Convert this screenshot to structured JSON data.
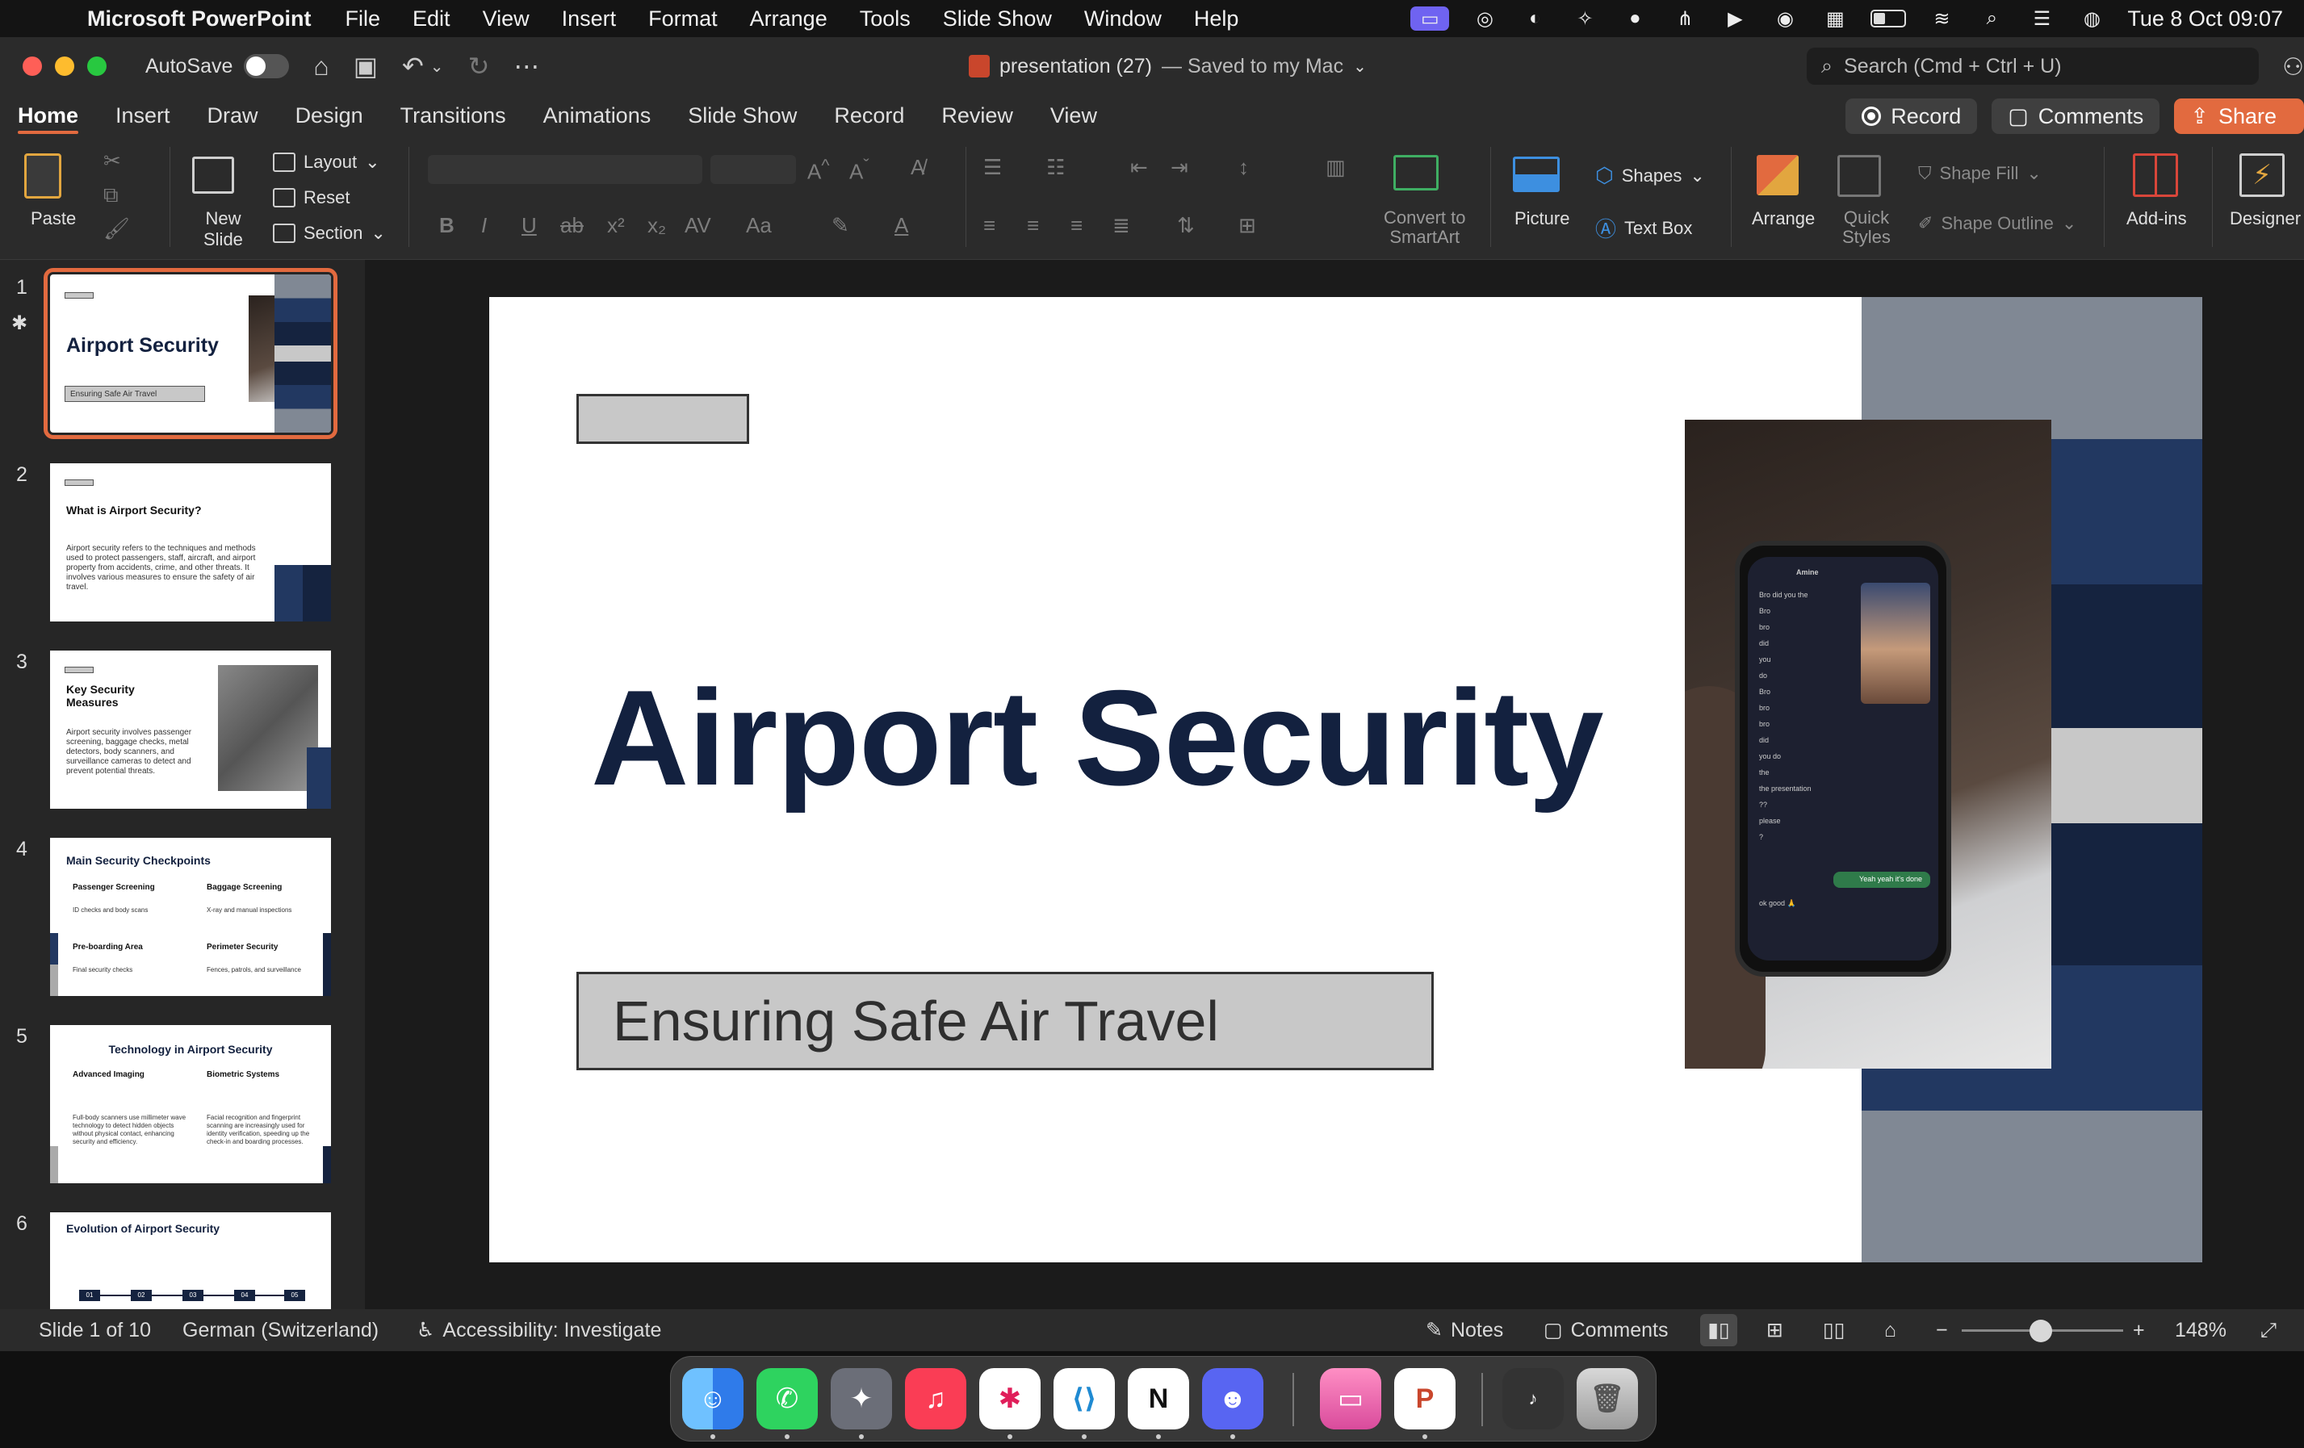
{
  "menubar": {
    "app_name": "Microsoft PowerPoint",
    "items": [
      "File",
      "Edit",
      "View",
      "Insert",
      "Format",
      "Arrange",
      "Tools",
      "Slide Show",
      "Window",
      "Help"
    ],
    "datetime": "Tue 8 Oct  09:07"
  },
  "titlebar": {
    "autosave_label": "AutoSave",
    "doc_name": "presentation (27)",
    "saved_status": "— Saved to my Mac",
    "search_placeholder": "Search (Cmd + Ctrl + U)"
  },
  "ribbon_tabs": [
    "Home",
    "Insert",
    "Draw",
    "Design",
    "Transitions",
    "Animations",
    "Slide Show",
    "Record",
    "Review",
    "View"
  ],
  "tab_actions": {
    "record": "Record",
    "comments": "Comments",
    "share": "Share"
  },
  "ribbon": {
    "paste": "Paste",
    "new_slide_line1": "New",
    "new_slide_line2": "Slide",
    "layout": "Layout",
    "reset": "Reset",
    "section": "Section",
    "convert_line1": "Convert to",
    "convert_line2": "SmartArt",
    "picture": "Picture",
    "shapes": "Shapes",
    "text_box": "Text Box",
    "arrange": "Arrange",
    "quick_styles_line1": "Quick",
    "quick_styles_line2": "Styles",
    "shape_fill": "Shape Fill",
    "shape_outline": "Shape Outline",
    "add_ins": "Add-ins",
    "designer": "Designer"
  },
  "thumbnails": [
    {
      "number": "1",
      "title": "Airport Security",
      "subtitle": "Ensuring Safe Air Travel"
    },
    {
      "number": "2",
      "title": "What is Airport Security?",
      "body": "Airport security refers to the techniques and methods used to protect passengers, staff, aircraft, and airport property from accidents, crime, and other threats. It involves various measures to ensure the safety of air travel."
    },
    {
      "number": "3",
      "title": "Key Security Measures",
      "body": "Airport security involves passenger screening, baggage checks, metal detectors, body scanners, and surveillance cameras to detect and prevent potential threats."
    },
    {
      "number": "4",
      "title": "Main Security Checkpoints",
      "cells": [
        {
          "heading": "Passenger Screening",
          "text": "ID checks and body scans"
        },
        {
          "heading": "Baggage Screening",
          "text": "X-ray and manual inspections"
        },
        {
          "heading": "Pre-boarding Area",
          "text": "Final security checks"
        },
        {
          "heading": "Perimeter Security",
          "text": "Fences, patrols, and surveillance"
        }
      ]
    },
    {
      "number": "5",
      "title": "Technology in Airport Security",
      "cells": [
        {
          "heading": "Advanced Imaging",
          "text": "Full-body scanners use millimeter wave technology to detect hidden objects without physical contact, enhancing security and efficiency."
        },
        {
          "heading": "Biometric Systems",
          "text": "Facial recognition and fingerprint scanning are increasingly used for identity verification, speeding up the check-in and boarding processes."
        }
      ]
    },
    {
      "number": "6",
      "title": "Evolution of Airport Security",
      "timeline": [
        "01",
        "02",
        "03",
        "04",
        "05"
      ]
    }
  ],
  "slide": {
    "title": "Airport Security",
    "subtitle": "Ensuring Safe Air Travel"
  },
  "phone_chat": {
    "contact": "Amine",
    "lines": [
      "Bro did you the",
      "Bro",
      "bro",
      "did",
      "you",
      "do",
      "Bro",
      "bro",
      "bro",
      "did",
      "you do",
      "the",
      "the presentation",
      "??",
      "please",
      "?"
    ],
    "reply": "Yeah yeah it's done",
    "last": "ok good 🙏"
  },
  "statusbar": {
    "slide_info": "Slide 1 of 10",
    "language": "German (Switzerland)",
    "accessibility": "Accessibility: Investigate",
    "notes": "Notes",
    "comments": "Comments",
    "zoom_minus": "−",
    "zoom_plus": "+",
    "zoom_level": "148%",
    "zoom_fraction": 0.49
  },
  "dock": {
    "apps": [
      "finder-icon",
      "whatsapp-icon",
      "affinity-icon",
      "music-icon",
      "slack-icon",
      "vscode-icon",
      "notion-icon",
      "discord-icon",
      "cleanmymac-icon",
      "powerpoint-icon",
      "music-widget-icon",
      "trash-icon"
    ]
  },
  "colors": {
    "accent": "#e26a3f",
    "slide_title": "#13213f",
    "block_gray": "#808894",
    "block_navy": "#223861",
    "block_dark": "#15233f",
    "block_light": "#c8c8c8"
  }
}
